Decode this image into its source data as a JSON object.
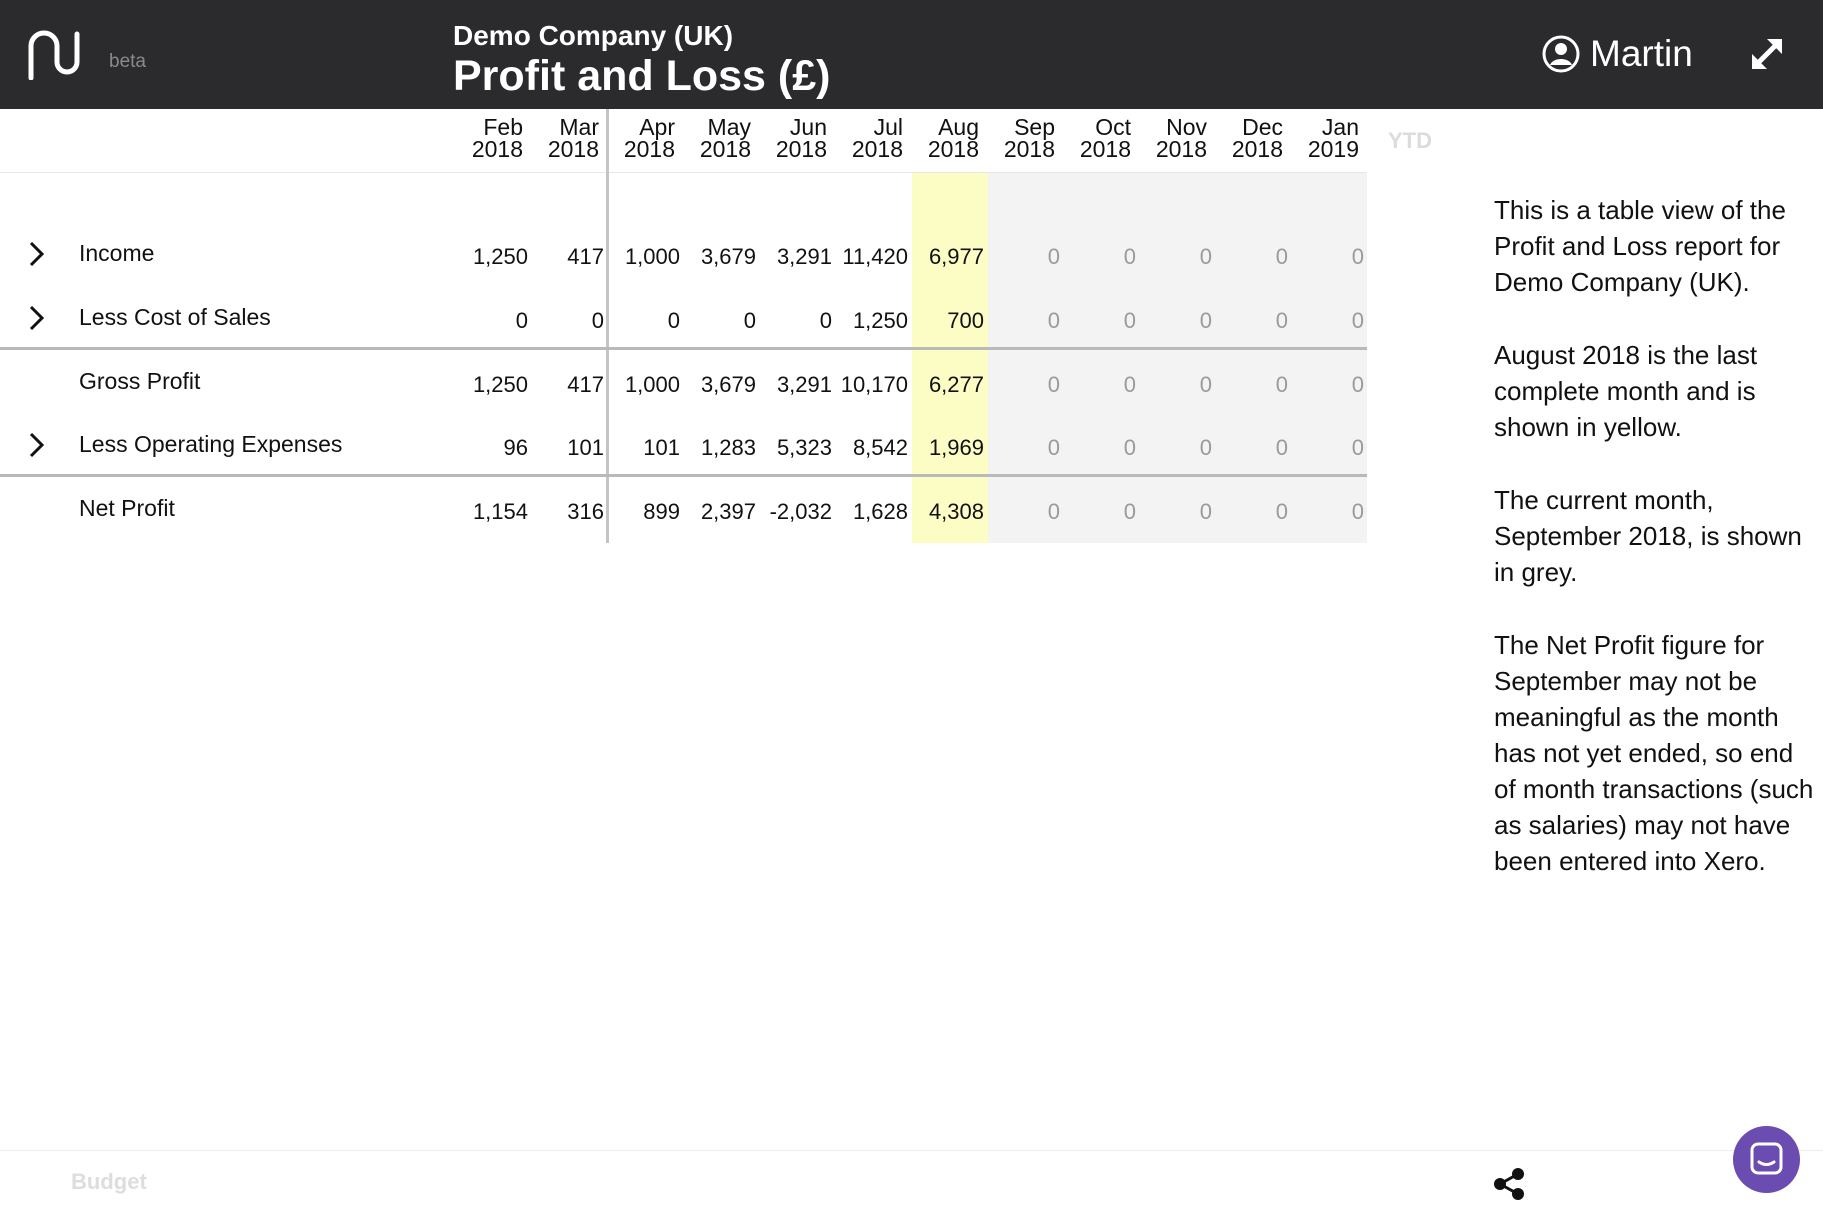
{
  "header": {
    "logo": "nu-logo",
    "beta": "beta",
    "company": "Demo Company (UK)",
    "title": "Profit and Loss (£)",
    "user": "Martin"
  },
  "columns": [
    {
      "month": "Feb",
      "year": "2018"
    },
    {
      "month": "Mar",
      "year": "2018"
    },
    {
      "month": "Apr",
      "year": "2018"
    },
    {
      "month": "May",
      "year": "2018"
    },
    {
      "month": "Jun",
      "year": "2018"
    },
    {
      "month": "Jul",
      "year": "2018"
    },
    {
      "month": "Aug",
      "year": "2018"
    },
    {
      "month": "Sep",
      "year": "2018"
    },
    {
      "month": "Oct",
      "year": "2018"
    },
    {
      "month": "Nov",
      "year": "2018"
    },
    {
      "month": "Dec",
      "year": "2018"
    },
    {
      "month": "Jan",
      "year": "2019"
    }
  ],
  "ytd_label": "YTD",
  "rows": [
    {
      "label": "Income",
      "values": [
        "1,250",
        "417",
        "1,000",
        "3,679",
        "3,291",
        "11,420",
        "6,977",
        "0",
        "0",
        "0",
        "0",
        "0"
      ]
    },
    {
      "label": "Less Cost of Sales",
      "values": [
        "0",
        "0",
        "0",
        "0",
        "0",
        "1,250",
        "700",
        "0",
        "0",
        "0",
        "0",
        "0"
      ]
    },
    {
      "label": "Gross Profit",
      "values": [
        "1,250",
        "417",
        "1,000",
        "3,679",
        "3,291",
        "10,170",
        "6,277",
        "0",
        "0",
        "0",
        "0",
        "0"
      ]
    },
    {
      "label": "Less Operating Expenses",
      "values": [
        "96",
        "101",
        "101",
        "1,283",
        "5,323",
        "8,542",
        "1,969",
        "0",
        "0",
        "0",
        "0",
        "0"
      ]
    },
    {
      "label": "Net Profit",
      "values": [
        "1,154",
        "316",
        "899",
        "2,397",
        "-2,032",
        "1,628",
        "4,308",
        "0",
        "0",
        "0",
        "0",
        "0"
      ]
    }
  ],
  "info": [
    "This is a table view of the Profit and Loss report for Demo Company (UK).",
    "August 2018 is the last complete month and is shown in yellow.",
    "The current month, September 2018, is shown in grey.",
    "The Net Profit figure for September may not be meaningful as the month has not yet ended, so end of month transactions (such as salaries) may not have been entered into Xero."
  ],
  "footer": {
    "budget": "Budget"
  },
  "colors": {
    "header_bg": "#2b2b2d",
    "last_complete_month": "#fbfdc5",
    "current_month": "#f3f3f3",
    "chat_button": "#6b4cb0"
  },
  "icons": {
    "logo": "nu-logo-icon",
    "user": "user-circle-icon",
    "expand": "expand-icon",
    "row_expand": "chevron-right-icon",
    "share": "share-icon",
    "chat": "chat-icon"
  }
}
